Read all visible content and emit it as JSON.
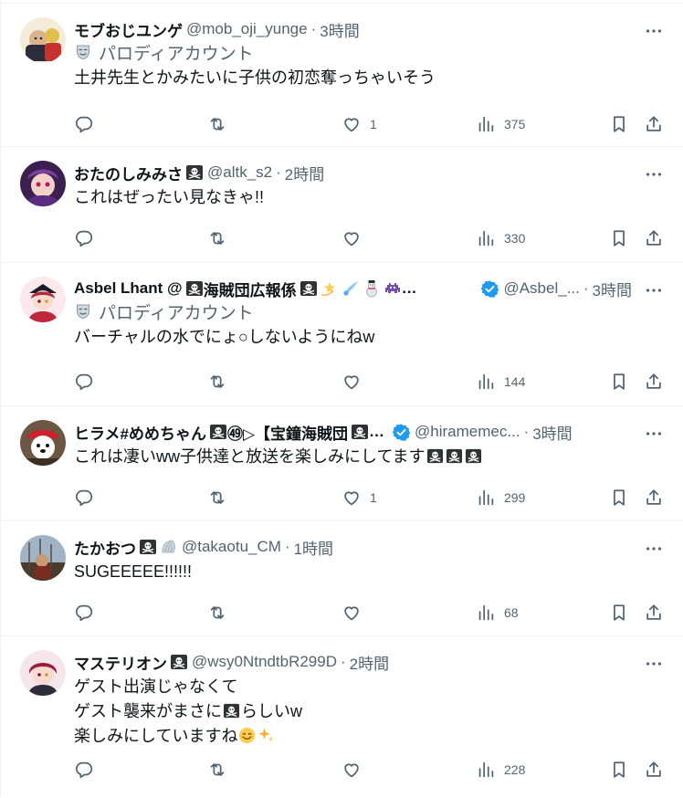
{
  "tweets": [
    {
      "name": "モブおじユンゲ",
      "handle": "@mob_oji_yunge",
      "time": "3時間",
      "label": "パロディアカウント",
      "text": [
        "土井先生とかみたいに子供の初恋奪っちゃいそう"
      ],
      "likes": "1",
      "views": "375"
    },
    {
      "name": "おたのしみみさ",
      "handle": "@altk_s2",
      "time": "2時間",
      "text": [
        "これはぜったい見なきゃ!!"
      ],
      "likes": "",
      "views": "330"
    },
    {
      "name": "Asbel Lhant @",
      "name_part2": "海賊団広報係",
      "handle": "@Asbel_...",
      "time": "3時間",
      "label": "パロディアカウント",
      "text": [
        "バーチャルの水でにょ○しないようにねw"
      ],
      "likes": "",
      "views": "144"
    },
    {
      "name": "ヒラメ#めめちゃん",
      "name_part2": "㊾▷【宝鐘海賊団",
      "handle": "@hiramemec...",
      "time": "3時間",
      "text": [
        "これは凄いww子供達と放送を楽しみにしてます"
      ],
      "likes": "1",
      "views": "299"
    },
    {
      "name": "たかおつ",
      "handle": "@takaotu_CM",
      "time": "1時間",
      "text": [
        "SUGEEEEE!!!!!!"
      ],
      "likes": "",
      "views": "68"
    },
    {
      "name": "マステリオン",
      "handle": "@wsy0NtndtbR299D",
      "time": "2時間",
      "text": [
        "ゲスト出演じゃなくて",
        "ゲスト襲来がまさに",
        "らしいw",
        "楽しみにしていますね"
      ],
      "likes": "",
      "views": "228"
    }
  ],
  "separators": {
    "dot": "·",
    "ellipsis": "…"
  },
  "icons": {
    "more": "more-horizontal-icon",
    "reply": "reply-icon",
    "retweet": "retweet-icon",
    "like": "heart-icon",
    "views": "views-bar-chart-icon",
    "bookmark": "bookmark-icon",
    "share": "share-icon",
    "verified": "verified-badge-icon",
    "parody": "parody-mask-icon",
    "skull": "pirate-flag-icon"
  },
  "colors": {
    "text": "#0f1419",
    "secondary": "#536471",
    "verified": "#1d9bf0",
    "divider": "#eff3f4"
  }
}
